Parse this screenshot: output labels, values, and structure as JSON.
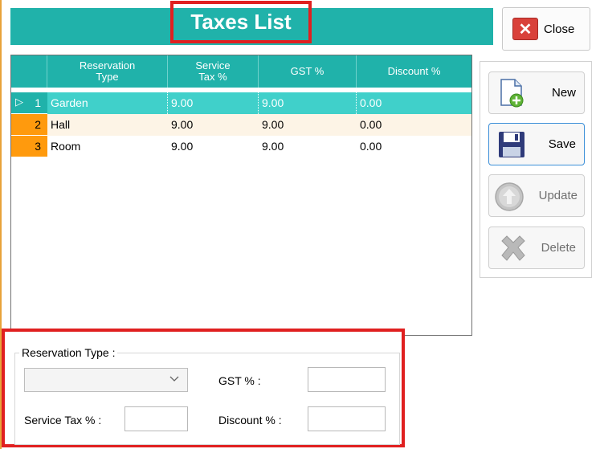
{
  "window": {
    "title": "Taxes List"
  },
  "close_button": {
    "label": "Close"
  },
  "grid": {
    "columns": [
      "Reservation\nType",
      "Service\nTax %",
      "GST %",
      "Discount %"
    ],
    "rows": [
      {
        "num": "1",
        "reservation_type": "Garden",
        "service_tax": "9.00",
        "gst": "9.00",
        "discount": "0.00",
        "selected": true
      },
      {
        "num": "2",
        "reservation_type": "Hall",
        "service_tax": "9.00",
        "gst": "9.00",
        "discount": "0.00"
      },
      {
        "num": "3",
        "reservation_type": "Room",
        "service_tax": "9.00",
        "gst": "9.00",
        "discount": "0.00"
      }
    ]
  },
  "actions": {
    "new_label": "New",
    "save_label": "Save",
    "update_label": "Update",
    "delete_label": "Delete"
  },
  "form": {
    "group_label": "Reservation Type :",
    "reservation_type_value": "",
    "gst_label": "GST % :",
    "gst_value": "",
    "service_tax_label": "Service Tax % :",
    "service_tax_value": "",
    "discount_label": "Discount % :",
    "discount_value": ""
  },
  "colors": {
    "accent": "#20b2aa",
    "selected_row": "#40d0ca",
    "row_header": "#ff9a0d",
    "highlight_border": "#e02020"
  }
}
